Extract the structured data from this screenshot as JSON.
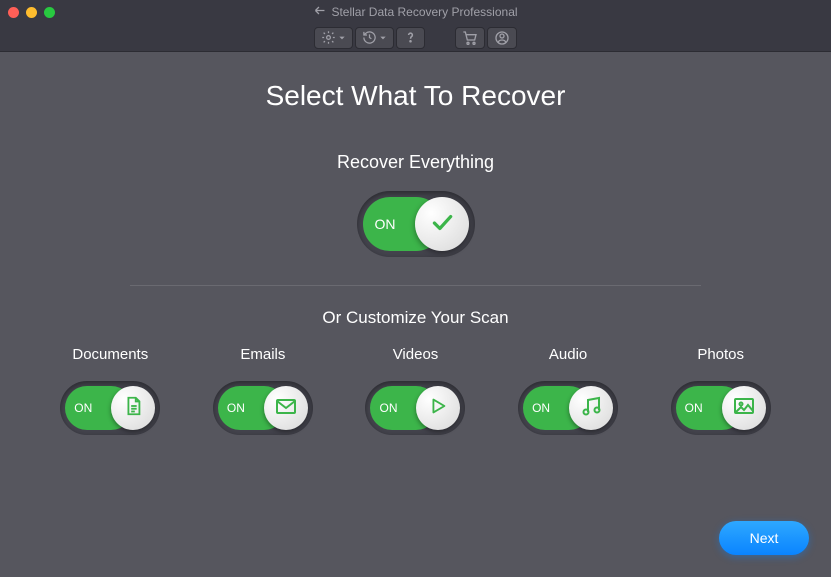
{
  "window": {
    "title": "Stellar Data Recovery Professional"
  },
  "toolbar": {
    "settings": "settings",
    "history": "history",
    "help": "help",
    "cart": "cart",
    "account": "account"
  },
  "headings": {
    "main": "Select What To Recover",
    "everything": "Recover Everything",
    "customize": "Or Customize Your Scan"
  },
  "toggle_on": "ON",
  "everything_toggle": {
    "label": "ON",
    "state": true
  },
  "categories": [
    {
      "label": "Documents",
      "icon": "document",
      "on_label": "ON",
      "state": true
    },
    {
      "label": "Emails",
      "icon": "mail",
      "on_label": "ON",
      "state": true
    },
    {
      "label": "Videos",
      "icon": "play",
      "on_label": "ON",
      "state": true
    },
    {
      "label": "Audio",
      "icon": "music",
      "on_label": "ON",
      "state": true
    },
    {
      "label": "Photos",
      "icon": "image",
      "on_label": "ON",
      "state": true
    }
  ],
  "buttons": {
    "next": "Next"
  },
  "colors": {
    "accent_green": "#3cb54a",
    "accent_blue": "#0a84ff",
    "bg": "#56565e",
    "chrome": "#393942"
  }
}
